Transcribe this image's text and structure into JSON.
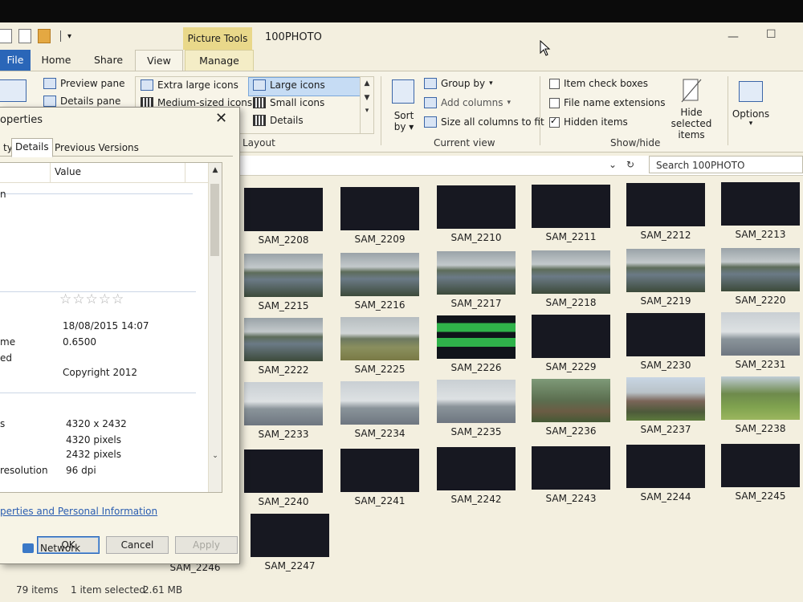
{
  "window": {
    "title": "100PHOTO",
    "contextual_tab_group": "Picture Tools"
  },
  "tabs": [
    {
      "label": "File"
    },
    {
      "label": "Home"
    },
    {
      "label": "Share"
    },
    {
      "label": "View"
    },
    {
      "label": "Manage"
    }
  ],
  "ribbon": {
    "panes": {
      "preview": "Preview pane",
      "details": "Details pane"
    },
    "layout": {
      "extra_large": "Extra large icons",
      "medium": "Medium-sized icons",
      "large": "Large icons",
      "small": "Small icons",
      "details": "Details",
      "group_label": "Layout"
    },
    "current_view": {
      "sort_by": "Sort by",
      "group_by": "Group by",
      "add_columns": "Add columns",
      "size_all": "Size all columns to fit",
      "group_label": "Current view"
    },
    "show_hide": {
      "item_checkboxes": "Item check boxes",
      "item_checkboxes_checked": false,
      "file_name_extensions": "File name extensions",
      "file_name_extensions_checked": false,
      "hidden_items": "Hidden items",
      "hidden_items_checked": true,
      "hide_selected": "Hide selected items",
      "group_label": "Show/hide"
    },
    "options": "Options"
  },
  "search": {
    "placeholder": "Search 100PHOTO"
  },
  "files": [
    {
      "name": "SAM_2208",
      "thumb": "black"
    },
    {
      "name": "SAM_2209",
      "thumb": "black"
    },
    {
      "name": "SAM_2210",
      "thumb": "black"
    },
    {
      "name": "SAM_2211",
      "thumb": "black"
    },
    {
      "name": "SAM_2212",
      "thumb": "black"
    },
    {
      "name": "SAM_2213",
      "thumb": "black"
    },
    {
      "name": "SAM_2215",
      "thumb": "land"
    },
    {
      "name": "SAM_2216",
      "thumb": "land"
    },
    {
      "name": "SAM_2217",
      "thumb": "land"
    },
    {
      "name": "SAM_2218",
      "thumb": "land"
    },
    {
      "name": "SAM_2219",
      "thumb": "land"
    },
    {
      "name": "SAM_2220",
      "thumb": "land"
    },
    {
      "name": "SAM_2222",
      "thumb": "land"
    },
    {
      "name": "SAM_2225",
      "thumb": "land2"
    },
    {
      "name": "SAM_2226",
      "thumb": "green"
    },
    {
      "name": "SAM_2229",
      "thumb": "black"
    },
    {
      "name": "SAM_2230",
      "thumb": "black"
    },
    {
      "name": "SAM_2231",
      "thumb": "beach"
    },
    {
      "name": "SAM_2233",
      "thumb": "beach"
    },
    {
      "name": "SAM_2234",
      "thumb": "beach"
    },
    {
      "name": "SAM_2235",
      "thumb": "beach"
    },
    {
      "name": "SAM_2236",
      "thumb": "tree"
    },
    {
      "name": "SAM_2237",
      "thumb": "castle"
    },
    {
      "name": "SAM_2238",
      "thumb": "park"
    },
    {
      "name": "SAM_2240",
      "thumb": "black"
    },
    {
      "name": "SAM_2241",
      "thumb": "black"
    },
    {
      "name": "SAM_2242",
      "thumb": "black"
    },
    {
      "name": "SAM_2243",
      "thumb": "black"
    },
    {
      "name": "SAM_2244",
      "thumb": "black"
    },
    {
      "name": "SAM_2245",
      "thumb": "black"
    },
    {
      "name": "SAM_2246",
      "thumb": "black"
    },
    {
      "name": "SAM_2247",
      "thumb": "black"
    }
  ],
  "dialog": {
    "title": "operties",
    "tabs": [
      "ty",
      "Details",
      "Previous Versions"
    ],
    "active_tab": "Details",
    "columns": {
      "value": "Value"
    },
    "rating_stars": "☆☆☆☆☆",
    "rows": [
      {
        "label": "n",
        "value": ""
      },
      {
        "label": "",
        "value": "18/08/2015 14:07"
      },
      {
        "label": "me",
        "value": "0.6500"
      },
      {
        "label": "ed",
        "value": ""
      },
      {
        "label": "",
        "value": "Copyright 2012"
      },
      {
        "label": "s",
        "value": "4320 x 2432"
      },
      {
        "label": "",
        "value": "4320 pixels"
      },
      {
        "label": "",
        "value": "2432 pixels"
      },
      {
        "label": "resolution",
        "value": "96 dpi"
      }
    ],
    "link": "perties and Personal Information",
    "buttons": {
      "ok": "OK",
      "cancel": "Cancel",
      "apply": "Apply"
    }
  },
  "nav": {
    "network": "Network"
  },
  "status": {
    "items": "79 items",
    "selected": "1 item selected",
    "size": "2.61 MB"
  }
}
